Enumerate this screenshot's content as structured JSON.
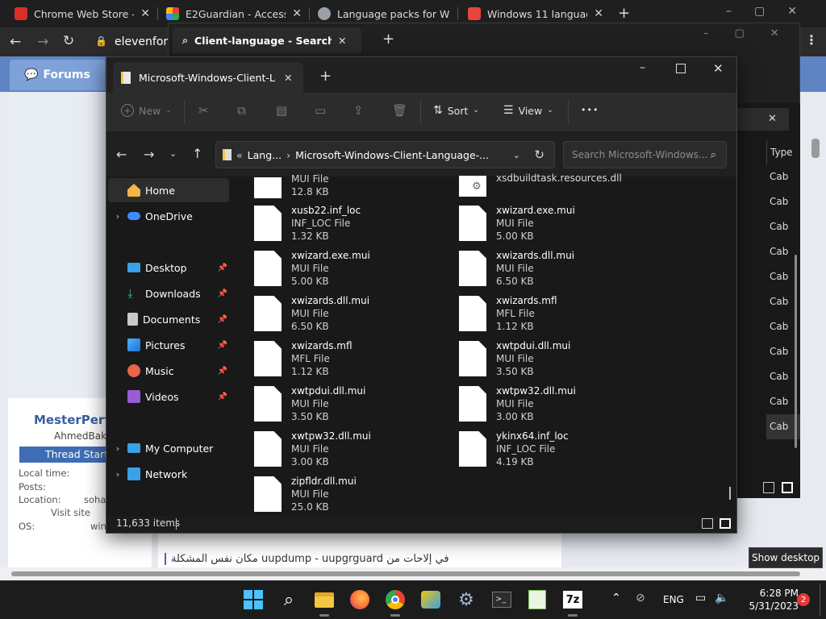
{
  "chrome": {
    "tabs": [
      {
        "label": "Chrome Web Store - E",
        "color": "#d93025"
      },
      {
        "label": "E2Guardian - Access D",
        "color": "#4285f4"
      },
      {
        "label": "Language packs for W",
        "color": "#9aa0a6"
      },
      {
        "label": "Windows 11 language",
        "color": "#e8453c"
      }
    ],
    "new_tab": "+",
    "url": "elevenforu",
    "site": {
      "forums_label": "Forums",
      "profile_name": "MesterPerf",
      "profile_sub": "AhmedBakr",
      "thread_starter": "Thread Starte",
      "fields": [
        {
          "k": "Local time:",
          "v": ""
        },
        {
          "k": "Posts:",
          "v": ""
        },
        {
          "k": "Location:",
          "v": "soha"
        },
        {
          "k": "Visit site",
          "v": ""
        },
        {
          "k": "OS:",
          "v": "win"
        }
      ],
      "post_snippet": "مكان نفس المشكلة  uupdump - uupgrguard في إلاحات من"
    }
  },
  "search_window": {
    "tab_label": "Client-language - Search Resul",
    "type_header": "Type",
    "type_cells": [
      "Cab",
      "Cab",
      "Cab",
      "Cab",
      "Cab",
      "Cab",
      "Cab",
      "Cab",
      "Cab",
      "Cab",
      "Cab",
      "Cab"
    ]
  },
  "explorer": {
    "tab_label": "Microsoft-Windows-Client-Lar",
    "toolbar": {
      "new": "New",
      "sort": "Sort",
      "view": "View",
      "more": "•••"
    },
    "address": {
      "prefix": "«",
      "crumb1": "Lang...",
      "sep": "›",
      "crumb2": "Microsoft-Windows-Client-Language-..."
    },
    "search_placeholder": "Search Microsoft-Windows...",
    "nav": [
      {
        "label": "Home"
      },
      {
        "label": "OneDrive"
      },
      {
        "label": "Desktop"
      },
      {
        "label": "Downloads"
      },
      {
        "label": "Documents"
      },
      {
        "label": "Pictures"
      },
      {
        "label": "Music"
      },
      {
        "label": "Videos"
      },
      {
        "label": "My Computer"
      },
      {
        "label": "Network"
      }
    ],
    "files_left": [
      {
        "name": "",
        "type": "MUI File",
        "size": "12.8 KB"
      },
      {
        "name": "xusb22.inf_loc",
        "type": "INF_LOC File",
        "size": "1.32 KB"
      },
      {
        "name": "xwizard.exe.mui",
        "type": "MUI File",
        "size": "5.00 KB"
      },
      {
        "name": "xwizards.dll.mui",
        "type": "MUI File",
        "size": "6.50 KB"
      },
      {
        "name": "xwizards.mfl",
        "type": "MFL File",
        "size": "1.12 KB"
      },
      {
        "name": "xwtpdui.dll.mui",
        "type": "MUI File",
        "size": "3.50 KB"
      },
      {
        "name": "xwtpw32.dll.mui",
        "type": "MUI File",
        "size": "3.00 KB"
      },
      {
        "name": "zipfldr.dll.mui",
        "type": "MUI File",
        "size": "25.0 KB"
      }
    ],
    "files_right": [
      {
        "name": "xsdbuildtask.resources.dll",
        "type": "",
        "size": ""
      },
      {
        "name": "xwizard.exe.mui",
        "type": "MUI File",
        "size": "5.00 KB"
      },
      {
        "name": "xwizards.dll.mui",
        "type": "MUI File",
        "size": "6.50 KB"
      },
      {
        "name": "xwizards.mfl",
        "type": "MFL File",
        "size": "1.12 KB"
      },
      {
        "name": "xwtpdui.dll.mui",
        "type": "MUI File",
        "size": "3.50 KB"
      },
      {
        "name": "xwtpw32.dll.mui",
        "type": "MUI File",
        "size": "3.00 KB"
      },
      {
        "name": "ykinx64.inf_loc",
        "type": "INF_LOC File",
        "size": "4.19 KB"
      }
    ],
    "status": "11,633 items"
  },
  "taskbar": {
    "tooltip": "Show desktop",
    "lang": "ENG",
    "time": "6:28 PM",
    "date": "5/31/2023",
    "notifications": "2",
    "app_7z": "7z"
  }
}
